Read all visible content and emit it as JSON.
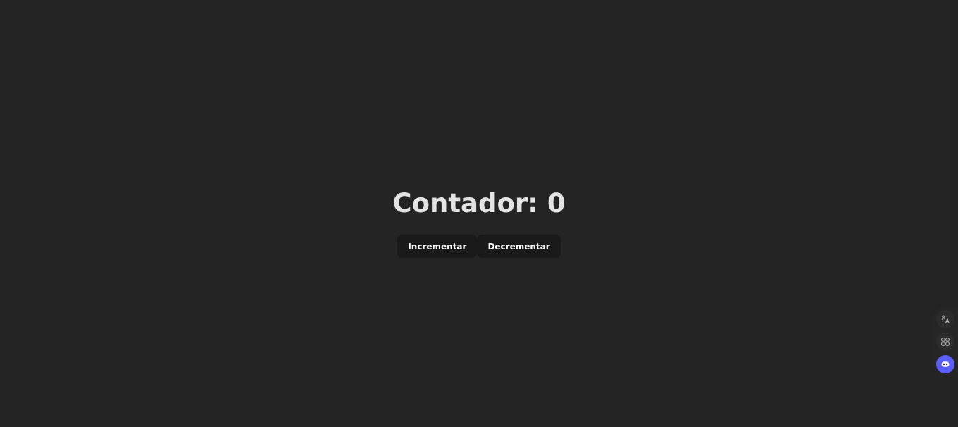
{
  "counter": {
    "label": "Contador",
    "value": 0,
    "text": "Contador: 0"
  },
  "buttons": {
    "increment_label": "Incrementar",
    "decrement_label": "Decrementar"
  },
  "side_dock": {
    "items": [
      {
        "name": "translate-icon"
      },
      {
        "name": "apps-grid-icon"
      },
      {
        "name": "assistant-icon"
      }
    ]
  },
  "colors": {
    "background": "#242424",
    "button_bg": "#1a1a1a",
    "text_primary": "#e3e3e3",
    "assistant_accent": "#5b5ff7"
  }
}
